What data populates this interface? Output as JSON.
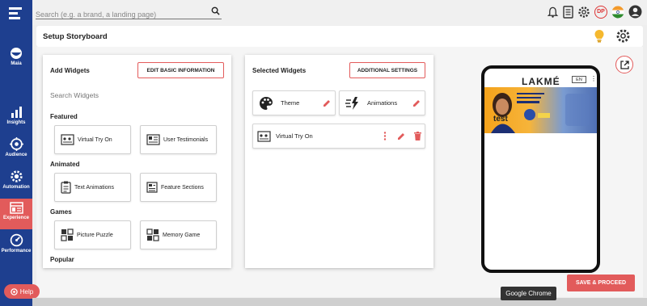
{
  "topbar": {
    "search_placeholder": "Search (e.g. a brand, a landing page)",
    "user_initials": "DP"
  },
  "sidebar": {
    "items": [
      {
        "label": "Maia",
        "icon": "maia-icon"
      },
      {
        "label": "Insights",
        "icon": "bar-chart-icon"
      },
      {
        "label": "Audience",
        "icon": "target-icon"
      },
      {
        "label": "Automation",
        "icon": "cog-icon"
      },
      {
        "label": "Experience",
        "icon": "layout-icon",
        "active": true
      },
      {
        "label": "Performance",
        "icon": "gauge-icon"
      }
    ],
    "help_label": "Help"
  },
  "header": {
    "title": "Setup Storyboard"
  },
  "add_widgets": {
    "title": "Add Widgets",
    "edit_button": "EDIT BASIC INFORMATION",
    "search_placeholder": "Search Widgets",
    "sections": [
      {
        "name": "Featured",
        "widgets": [
          "Virtual Try On",
          "User Testimonials"
        ]
      },
      {
        "name": "Animated",
        "widgets": [
          "Text Animations",
          "Feature Sections"
        ]
      },
      {
        "name": "Games",
        "widgets": [
          "Picture Puzzle",
          "Memory Game"
        ]
      },
      {
        "name": "Popular",
        "widgets": []
      }
    ]
  },
  "selected_widgets": {
    "title": "Selected Widgets",
    "settings_button": "ADDITIONAL SETTINGS",
    "items": [
      "Theme",
      "Animations",
      "Virtual Try On"
    ]
  },
  "preview": {
    "brand": "LAKMÉ",
    "language": "EN",
    "banner_text": "test"
  },
  "actions": {
    "save_proceed": "SAVE & PROCEED"
  },
  "tooltip": "Google Chrome",
  "colors": {
    "sidebar": "#1e3f8f",
    "accent": "#e25b5b"
  }
}
